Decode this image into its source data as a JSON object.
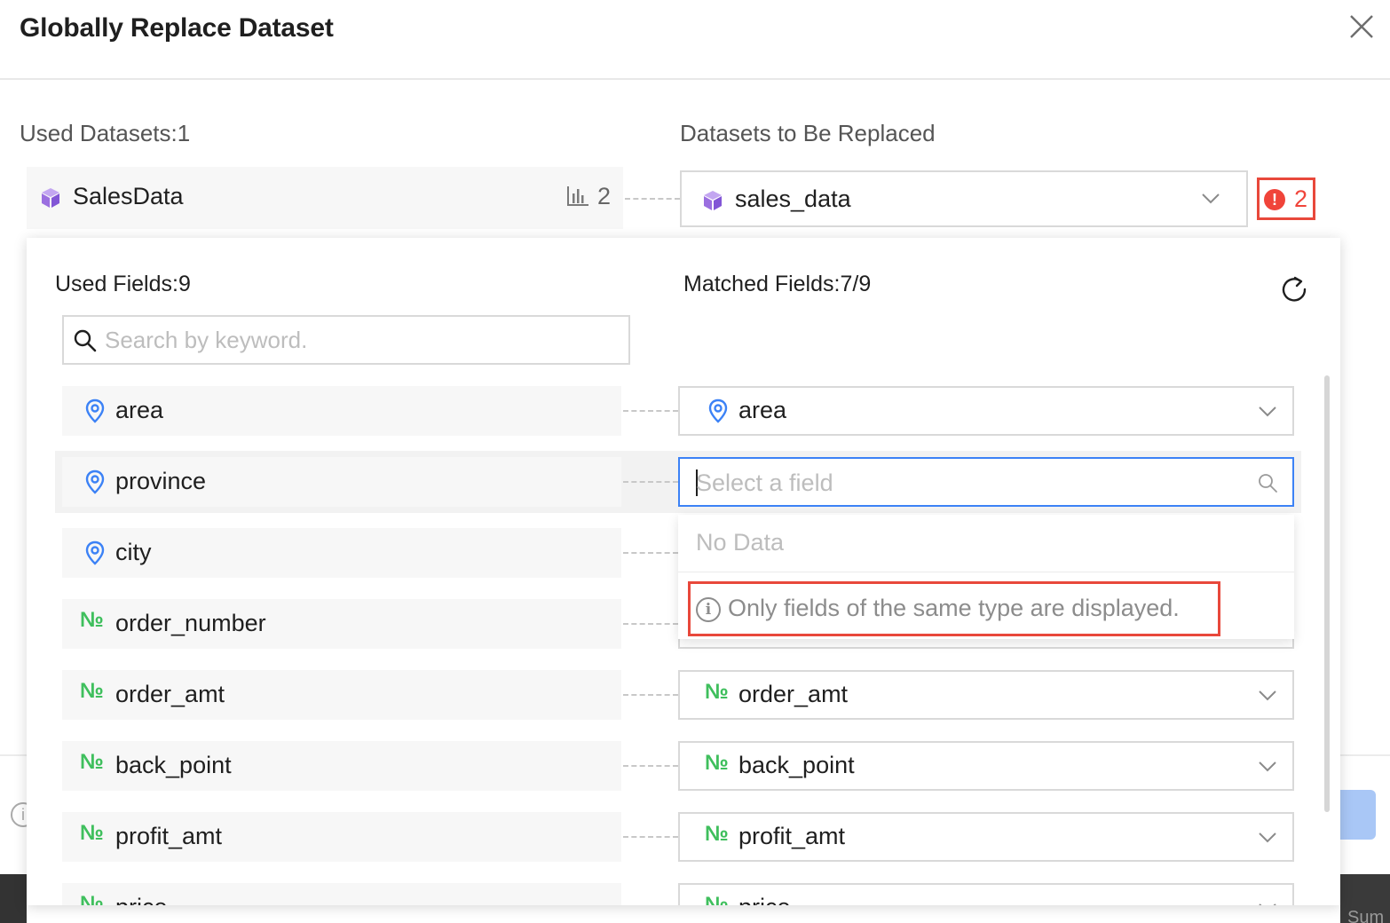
{
  "dialog": {
    "title": "Globally Replace Dataset",
    "close_icon": "close-icon"
  },
  "used_datasets": {
    "label": "Used Datasets:1",
    "items": [
      {
        "name": "SalesData",
        "icon": "cube-icon",
        "chart_icon": "bar-chart-icon",
        "chart_count": "2"
      }
    ]
  },
  "replace": {
    "label": "Datasets to Be Replaced",
    "selected": "sales_data",
    "warning_count": "2",
    "warning_icon": "exclamation-icon"
  },
  "fields_panel": {
    "used_label": "Used Fields:9",
    "matched_label": "Matched Fields:7/9",
    "refresh_icon": "refresh-icon",
    "search_placeholder": "Search by keyword.",
    "rows": [
      {
        "name": "area",
        "type": "geo",
        "matched": "area"
      },
      {
        "name": "province",
        "type": "geo",
        "matched": ""
      },
      {
        "name": "city",
        "type": "geo",
        "matched": ""
      },
      {
        "name": "order_number",
        "type": "number",
        "matched": ""
      },
      {
        "name": "order_amt",
        "type": "number",
        "matched": "order_amt"
      },
      {
        "name": "back_point",
        "type": "number",
        "matched": "back_point"
      },
      {
        "name": "profit_amt",
        "type": "number",
        "matched": "profit_amt"
      },
      {
        "name": "price",
        "type": "number",
        "matched": "price"
      }
    ],
    "type_icons": {
      "geo": "location-pin-icon",
      "number": "numero-icon",
      "numero_glyph": "№"
    },
    "active_select_placeholder": "Select a field",
    "dropdown": {
      "no_data": "No Data",
      "hint": "Only fields of the same type are displayed."
    }
  },
  "background": {
    "footer_text_fragment": "Sum"
  },
  "colors": {
    "accent": "#3c82f6",
    "warning": "#f0443a",
    "geo_icon": "#3c82f6",
    "number_icon": "#3fbf5d",
    "cube": "#9b6fe0"
  }
}
